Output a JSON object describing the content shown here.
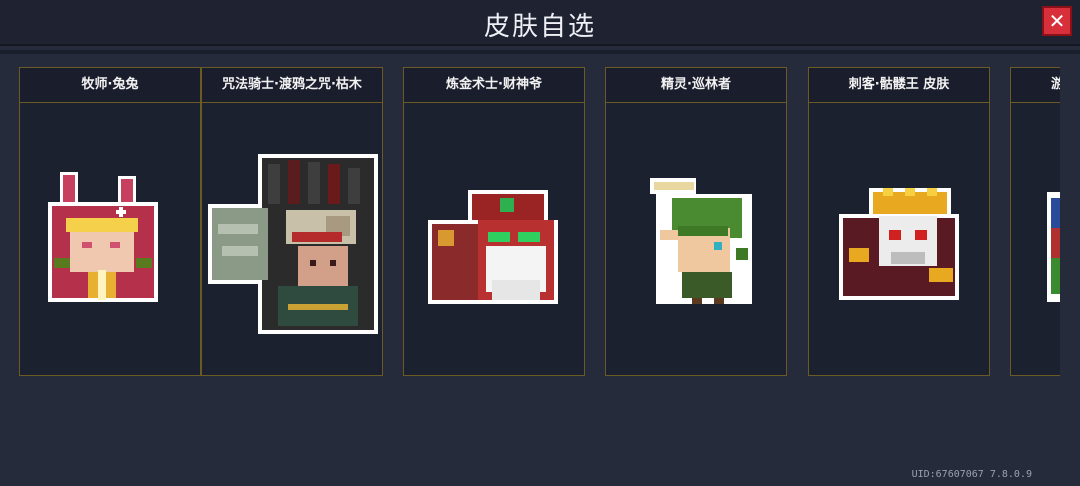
{
  "header": {
    "title": "皮肤自选",
    "close_icon": "close-icon"
  },
  "skins": [
    {
      "label": "牧师·兔兔",
      "icon": "priest-bunny-skin-icon"
    },
    {
      "label": "咒法骑士·渡鸦之咒·枯木",
      "icon": "raven-curse-knight-skin-icon"
    },
    {
      "label": "炼金术士·财神爷",
      "icon": "alchemist-fortune-god-skin-icon"
    },
    {
      "label": "精灵·巡林者",
      "icon": "elf-ranger-skin-icon"
    },
    {
      "label": "刺客·骷髅王 皮肤",
      "icon": "assassin-skeleton-king-skin-icon"
    },
    {
      "label": "游",
      "icon": "partial-skin-icon"
    }
  ],
  "footer": {
    "uid_text": "UID:67607067 7.8.0.9"
  },
  "colors": {
    "background": "#262b3b",
    "card_border": "#6b5a24",
    "close_red": "#d8303a"
  }
}
